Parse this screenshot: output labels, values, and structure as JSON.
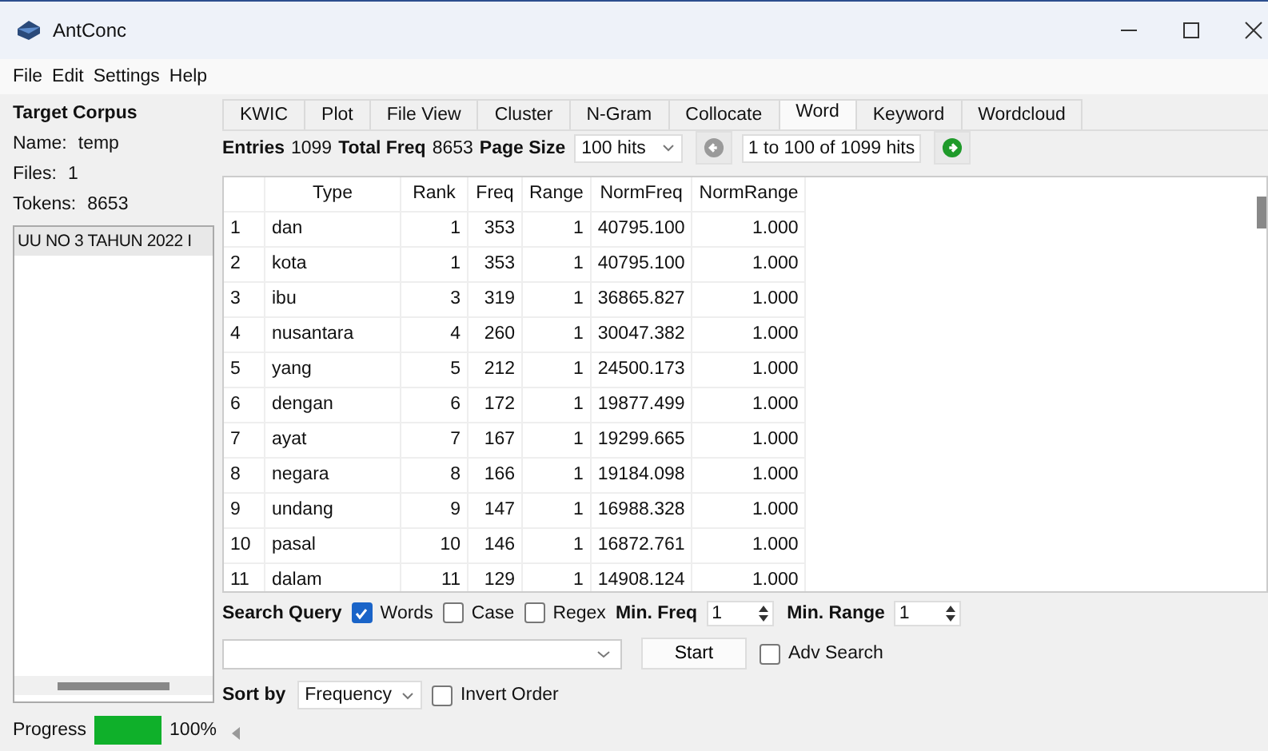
{
  "window": {
    "title": "AntConc"
  },
  "menu": [
    "File",
    "Edit",
    "Settings",
    "Help"
  ],
  "corpus": {
    "heading": "Target Corpus",
    "fields": [
      {
        "label": "Name:",
        "value": "temp"
      },
      {
        "label": "Files:",
        "value": "1"
      },
      {
        "label": "Tokens:",
        "value": "8653"
      }
    ],
    "files": [
      {
        "name": "UU NO 3 TAHUN 2022 I",
        "selected": true
      }
    ]
  },
  "tabs": [
    {
      "label": "KWIC",
      "selected": false
    },
    {
      "label": "Plot",
      "selected": false
    },
    {
      "label": "File View",
      "selected": false
    },
    {
      "label": "Cluster",
      "selected": false
    },
    {
      "label": "N-Gram",
      "selected": false
    },
    {
      "label": "Collocate",
      "selected": false
    },
    {
      "label": "Word",
      "selected": true
    },
    {
      "label": "Keyword",
      "selected": false
    },
    {
      "label": "Wordcloud",
      "selected": false
    }
  ],
  "summary": {
    "entries_label": "Entries",
    "entries": "1099",
    "total_label": "Total Freq",
    "total": "8653",
    "page_size_label": "Page Size",
    "page_size": "100 hits",
    "hits": "1 to 100 of 1099 hits"
  },
  "table": {
    "columns": [
      "Type",
      "Rank",
      "Freq",
      "Range",
      "NormFreq",
      "NormRange"
    ],
    "rows": [
      {
        "num": "1",
        "cells": [
          "dan",
          "1",
          "353",
          "1",
          "40795.100",
          "1.000"
        ]
      },
      {
        "num": "2",
        "cells": [
          "kota",
          "1",
          "353",
          "1",
          "40795.100",
          "1.000"
        ]
      },
      {
        "num": "3",
        "cells": [
          "ibu",
          "3",
          "319",
          "1",
          "36865.827",
          "1.000"
        ]
      },
      {
        "num": "4",
        "cells": [
          "nusantara",
          "4",
          "260",
          "1",
          "30047.382",
          "1.000"
        ]
      },
      {
        "num": "5",
        "cells": [
          "yang",
          "5",
          "212",
          "1",
          "24500.173",
          "1.000"
        ]
      },
      {
        "num": "6",
        "cells": [
          "dengan",
          "6",
          "172",
          "1",
          "19877.499",
          "1.000"
        ]
      },
      {
        "num": "7",
        "cells": [
          "ayat",
          "7",
          "167",
          "1",
          "19299.665",
          "1.000"
        ]
      },
      {
        "num": "8",
        "cells": [
          "negara",
          "8",
          "166",
          "1",
          "19184.098",
          "1.000"
        ]
      },
      {
        "num": "9",
        "cells": [
          "undang",
          "9",
          "147",
          "1",
          "16988.328",
          "1.000"
        ]
      },
      {
        "num": "10",
        "cells": [
          "pasal",
          "10",
          "146",
          "1",
          "16872.761",
          "1.000"
        ]
      },
      {
        "num": "11",
        "cells": [
          "dalam",
          "11",
          "129",
          "1",
          "14908.124",
          "1.000"
        ]
      }
    ]
  },
  "search": {
    "label": "Search Query",
    "options": [
      {
        "label": "Words",
        "checked": true
      },
      {
        "label": "Case",
        "checked": false
      },
      {
        "label": "Regex",
        "checked": false
      }
    ],
    "min_freq_label": "Min. Freq",
    "min_freq": "1",
    "min_range_label": "Min. Range",
    "min_range": "1",
    "start": "Start",
    "adv": {
      "label": "Adv Search",
      "checked": false
    },
    "sort_label": "Sort by",
    "sort_value": "Frequency",
    "invert": {
      "label": "Invert Order",
      "checked": false
    }
  },
  "progress": {
    "label": "Progress",
    "level": 1,
    "reading": "100%"
  }
}
